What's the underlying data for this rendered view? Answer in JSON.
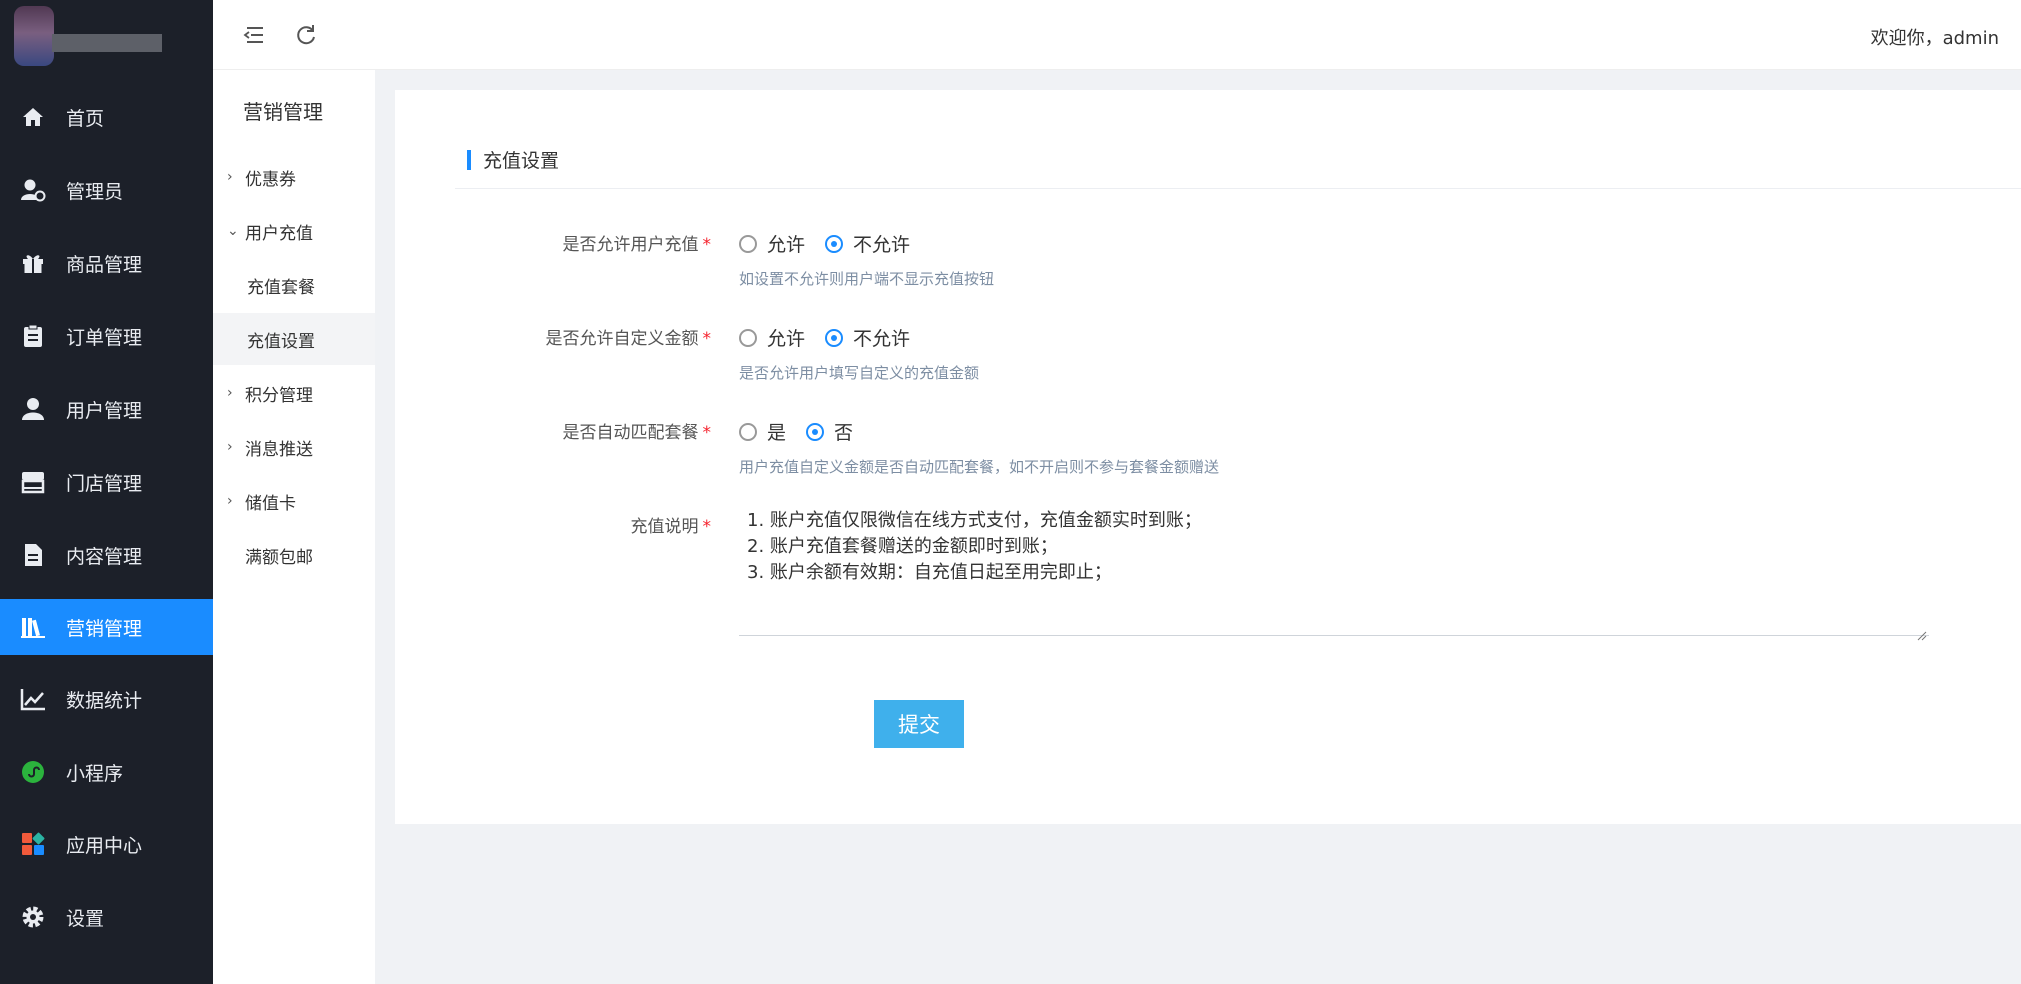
{
  "sidebar": {
    "items": [
      {
        "label": "首页",
        "icon": "home-icon"
      },
      {
        "label": "管理员",
        "icon": "admin-user-icon"
      },
      {
        "label": "商品管理",
        "icon": "gift-icon"
      },
      {
        "label": "订单管理",
        "icon": "clipboard-icon"
      },
      {
        "label": "用户管理",
        "icon": "user-icon"
      },
      {
        "label": "门店管理",
        "icon": "store-icon"
      },
      {
        "label": "内容管理",
        "icon": "document-icon"
      },
      {
        "label": "营销管理",
        "icon": "books-icon",
        "active": true
      },
      {
        "label": "数据统计",
        "icon": "line-chart-icon"
      },
      {
        "label": "小程序",
        "icon": "mini-program-icon"
      },
      {
        "label": "应用中心",
        "icon": "apps-icon"
      },
      {
        "label": "设置",
        "icon": "gear-icon"
      }
    ]
  },
  "subnav": {
    "title": "营销管理",
    "items": [
      {
        "label": "优惠券",
        "chevron": ">"
      },
      {
        "label": "用户充值",
        "chevron": "v"
      },
      {
        "label": "充值套餐"
      },
      {
        "label": "充值设置",
        "selected": true
      },
      {
        "label": "积分管理",
        "chevron": ">"
      },
      {
        "label": "消息推送",
        "chevron": ">"
      },
      {
        "label": "储值卡",
        "chevron": ">"
      },
      {
        "label": "满额包邮"
      }
    ]
  },
  "header": {
    "welcome": "欢迎你，admin"
  },
  "card": {
    "title": "充值设置",
    "fields": [
      {
        "label": "是否允许用户充值",
        "required": "*",
        "options": [
          {
            "label": "允许",
            "checked": false
          },
          {
            "label": "不允许",
            "checked": true
          }
        ],
        "hint": "如设置不允许则用户端不显示充值按钮"
      },
      {
        "label": "是否允许自定义金额",
        "required": "*",
        "options": [
          {
            "label": "允许",
            "checked": false
          },
          {
            "label": "不允许",
            "checked": true
          }
        ],
        "hint": "是否允许用户填写自定义的充值金额"
      },
      {
        "label": "是否自动匹配套餐",
        "required": "*",
        "options": [
          {
            "label": "是",
            "checked": false
          },
          {
            "label": "否",
            "checked": true
          }
        ],
        "hint": "用户充值自定义金额是否自动匹配套餐，如不开启则不参与套餐金额赠送"
      }
    ],
    "description": {
      "label": "充值说明",
      "required": "*",
      "lines": [
        "1. 账户充值仅限微信在线方式支付，充值金额实时到账；",
        "2. 账户充值套餐赠送的金额即时到账；",
        "3. 账户余额有效期：自充值日起至用完即止；"
      ]
    },
    "submit_label": "提交"
  },
  "colors": {
    "sidebar_bg": "#1c2029",
    "accent": "#1a8cff",
    "submit_bg": "#3fb0ec",
    "required": "#f5222d"
  }
}
